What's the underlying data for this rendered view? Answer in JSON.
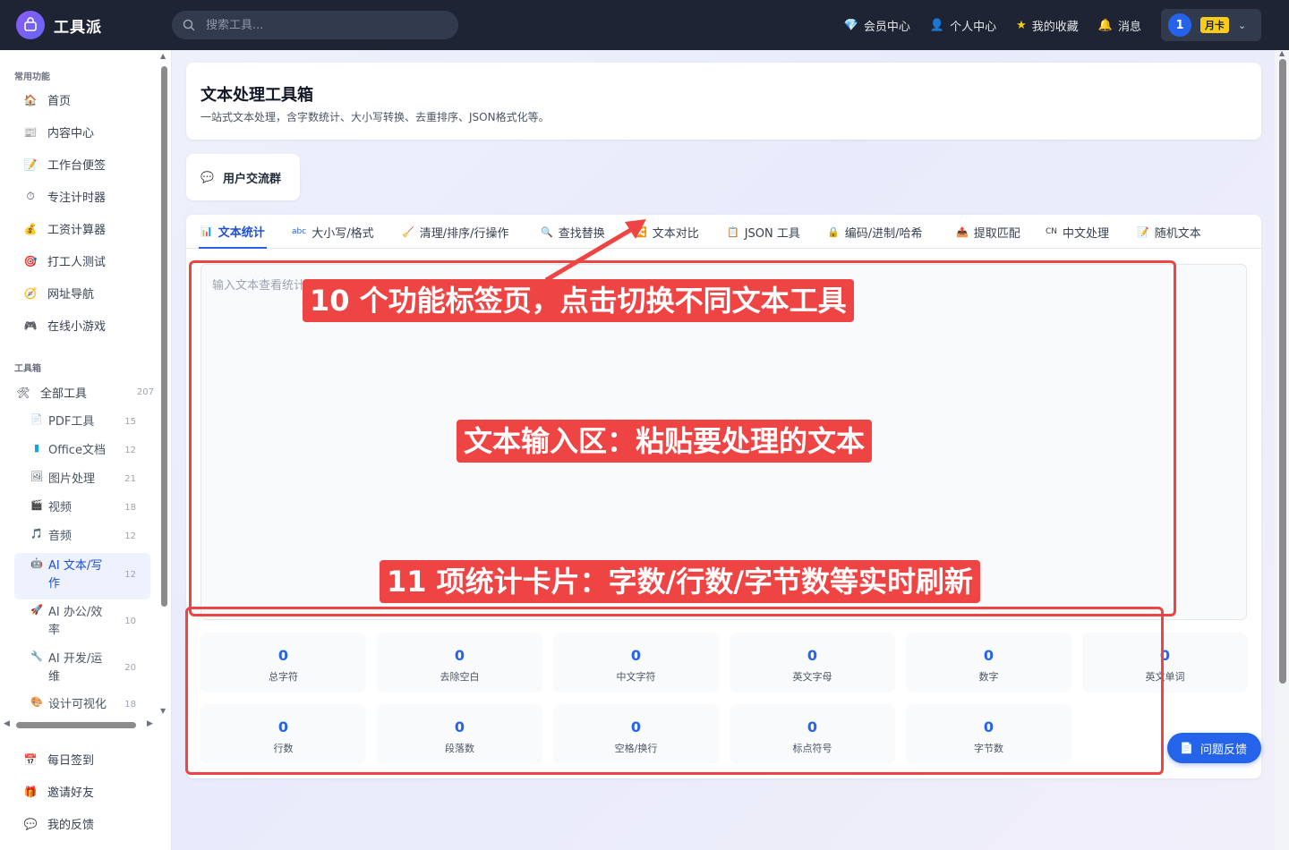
{
  "app": {
    "name": "工具派"
  },
  "search": {
    "placeholder": "搜索工具..."
  },
  "topnav": [
    {
      "icon": "gem-icon",
      "label": "会员中心"
    },
    {
      "icon": "person-icon",
      "label": "个人中心"
    },
    {
      "icon": "star-icon",
      "label": "我的收藏"
    },
    {
      "icon": "bell-icon",
      "label": "消息"
    }
  ],
  "user": {
    "avatar_text": "1",
    "badge": "月卡"
  },
  "sidebar": {
    "common_title": "常用功能",
    "common": [
      "首页",
      "内容中心",
      "工作台便签",
      "专注计时器",
      "工资计算器",
      "打工人测试",
      "网址导航",
      "在线小游戏"
    ],
    "toolbox_title": "工具箱",
    "all_tools": {
      "label": "全部工具",
      "count": "207"
    },
    "categories": [
      {
        "label": "PDF工具",
        "count": "15"
      },
      {
        "label": "Office文档",
        "count": "12"
      },
      {
        "label": "图片处理",
        "count": "21"
      },
      {
        "label": "视频",
        "count": "18"
      },
      {
        "label": "音频",
        "count": "12"
      },
      {
        "label": "AI 文本/写作",
        "count": "12"
      },
      {
        "label": "AI 办公/效率",
        "count": "10"
      },
      {
        "label": "AI 开发/运维",
        "count": "20"
      },
      {
        "label": "设计可视化",
        "count": "18"
      }
    ],
    "bottom": [
      "每日签到",
      "邀请好友",
      "我的反馈"
    ]
  },
  "header": {
    "title": "文本处理工具箱",
    "subtitle": "一站式文本处理，含字数统计、大小写转换、去重排序、JSON格式化等。"
  },
  "group_button": "用户交流群",
  "tabs": [
    {
      "icon": "chart-icon",
      "label": "文本统计"
    },
    {
      "icon": "abc-icon",
      "label": "大小写/格式"
    },
    {
      "icon": "broom-icon",
      "label": "清理/排序/行操作"
    },
    {
      "icon": "search-icon",
      "label": "查找替换"
    },
    {
      "icon": "compare-icon",
      "label": "文本对比"
    },
    {
      "icon": "clipboard-icon",
      "label": "JSON 工具"
    },
    {
      "icon": "lock-icon",
      "label": "编码/进制/哈希"
    },
    {
      "icon": "extract-icon",
      "label": "提取匹配"
    },
    {
      "icon": "cn-icon",
      "label": "中文处理"
    },
    {
      "icon": "memo-icon",
      "label": "随机文本"
    }
  ],
  "input": {
    "placeholder": "输入文本查看统计"
  },
  "stats": [
    {
      "value": "0",
      "label": "总字符"
    },
    {
      "value": "0",
      "label": "去除空白"
    },
    {
      "value": "0",
      "label": "中文字符"
    },
    {
      "value": "0",
      "label": "英文字母"
    },
    {
      "value": "0",
      "label": "数字"
    },
    {
      "value": "0",
      "label": "英文单词"
    },
    {
      "value": "0",
      "label": "行数"
    },
    {
      "value": "0",
      "label": "段落数"
    },
    {
      "value": "0",
      "label": "空格/换行"
    },
    {
      "value": "0",
      "label": "标点符号"
    },
    {
      "value": "0",
      "label": "字节数"
    }
  ],
  "feedback_button": "问题反馈",
  "annotations": {
    "tabs": "10 个功能标签页，点击切换不同文本工具",
    "input": "文本输入区：粘贴要处理的文本",
    "stats": "11 项统计卡片：字数/行数/字节数等实时刷新"
  },
  "colors": {
    "accent": "#2563eb",
    "annotation": "#ef4444",
    "topbar": "#1e2433"
  }
}
